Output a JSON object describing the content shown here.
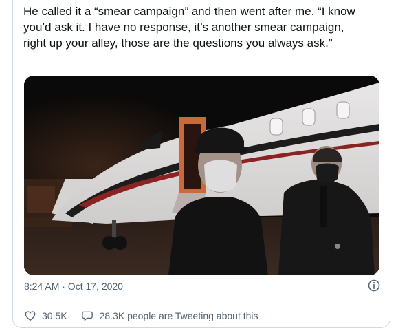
{
  "tweet": {
    "text": "He called it a “smear campaign” and then went after me. “I know you’d ask it. I have no response, it’s another smear campaign, right up your alley, those are the questions you always ask.”",
    "timestamp": "8:24 AM · Oct 17, 2020",
    "media": {
      "kind": "video-thumbnail"
    },
    "info_icon": "info-circle-icon",
    "likes": {
      "icon": "heart-outline-icon",
      "count": "30.5K"
    },
    "conversation": {
      "icon": "speech-bubble-icon",
      "label": "28.3K people are Tweeting about this"
    }
  },
  "colors": {
    "text_primary": "#0f1419",
    "text_secondary": "#536471",
    "border": "#cfd9de",
    "divider": "#eff3f4"
  }
}
